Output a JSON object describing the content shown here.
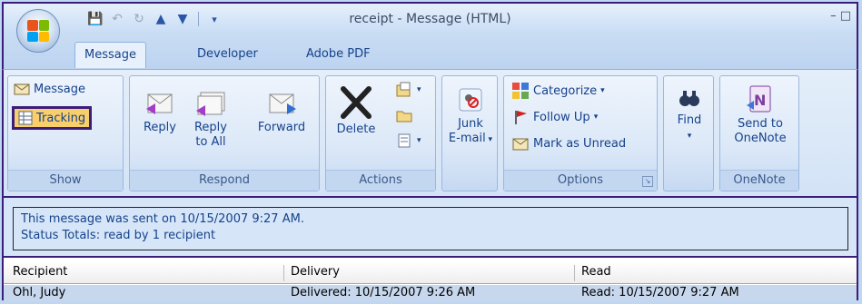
{
  "window": {
    "title": "receipt - Message (HTML)"
  },
  "tabs": [
    {
      "label": "Message",
      "active": true
    },
    {
      "label": "Developer",
      "active": false
    },
    {
      "label": "Adobe PDF",
      "active": false
    }
  ],
  "groups": {
    "show": {
      "label": "Show",
      "message": "Message",
      "tracking": "Tracking"
    },
    "respond": {
      "label": "Respond",
      "reply": "Reply",
      "reply_all_1": "Reply",
      "reply_all_2": "to All",
      "forward": "Forward"
    },
    "actions": {
      "label": "Actions",
      "delete": "Delete"
    },
    "junk": {
      "line1": "Junk",
      "line2": "E-mail"
    },
    "options": {
      "label": "Options",
      "categorize": "Categorize",
      "follow_up": "Follow Up",
      "mark_unread": "Mark as Unread"
    },
    "find": {
      "label": "Find"
    },
    "onenote": {
      "label": "OneNote",
      "line1": "Send to",
      "line2": "OneNote"
    }
  },
  "info": {
    "line1": "This message was sent on 10/15/2007 9:27 AM.",
    "line2": "Status Totals: read by 1 recipient"
  },
  "tracking_table": {
    "columns": [
      "Recipient",
      "Delivery",
      "Read"
    ],
    "rows": [
      [
        "Ohl, Judy",
        "Delivered: 10/15/2007 9:26 AM",
        "Read: 10/15/2007 9:27 AM"
      ]
    ]
  },
  "colors": {
    "highlight_border": "#3b1d7a",
    "accent": "#15428b",
    "tracking_bg": "#f9cf6b"
  }
}
